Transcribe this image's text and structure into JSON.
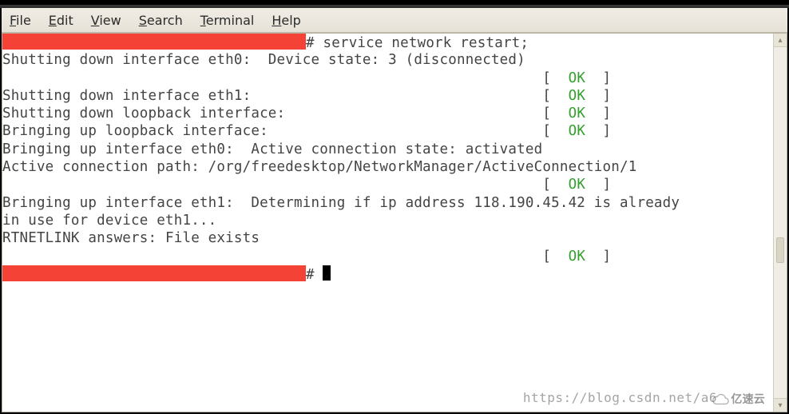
{
  "menu": {
    "file": "File",
    "edit": "Edit",
    "view": "View",
    "search": "Search",
    "terminal": "Terminal",
    "help": "Help"
  },
  "term": {
    "prompt_suffix": "# ",
    "command": "service network restart;",
    "l1": "Shutting down interface eth0:  Device state: 3 (disconnected)",
    "ok": "OK",
    "lb": "[  ",
    "rb": "  ]",
    "l3": "Shutting down interface eth1:                               ",
    "l4": "Shutting down loopback interface:                           ",
    "l5": "Bringing up loopback interface:                             ",
    "l6": "Bringing up interface eth0:  Active connection state: activated",
    "l7": "Active connection path: /org/freedesktop/NetworkManager/ActiveConnection/1",
    "l8pad": "                                                            ",
    "l9": "Bringing up interface eth1:  Determining if ip address 118.190.45.42 is already ",
    "l10": "in use for device eth1...",
    "l11": "RTNETLINK answers: File exists",
    "l12pad": "                                                            "
  },
  "watermark": "https://blog.csdn.net/a6",
  "logo_text": "亿速云"
}
